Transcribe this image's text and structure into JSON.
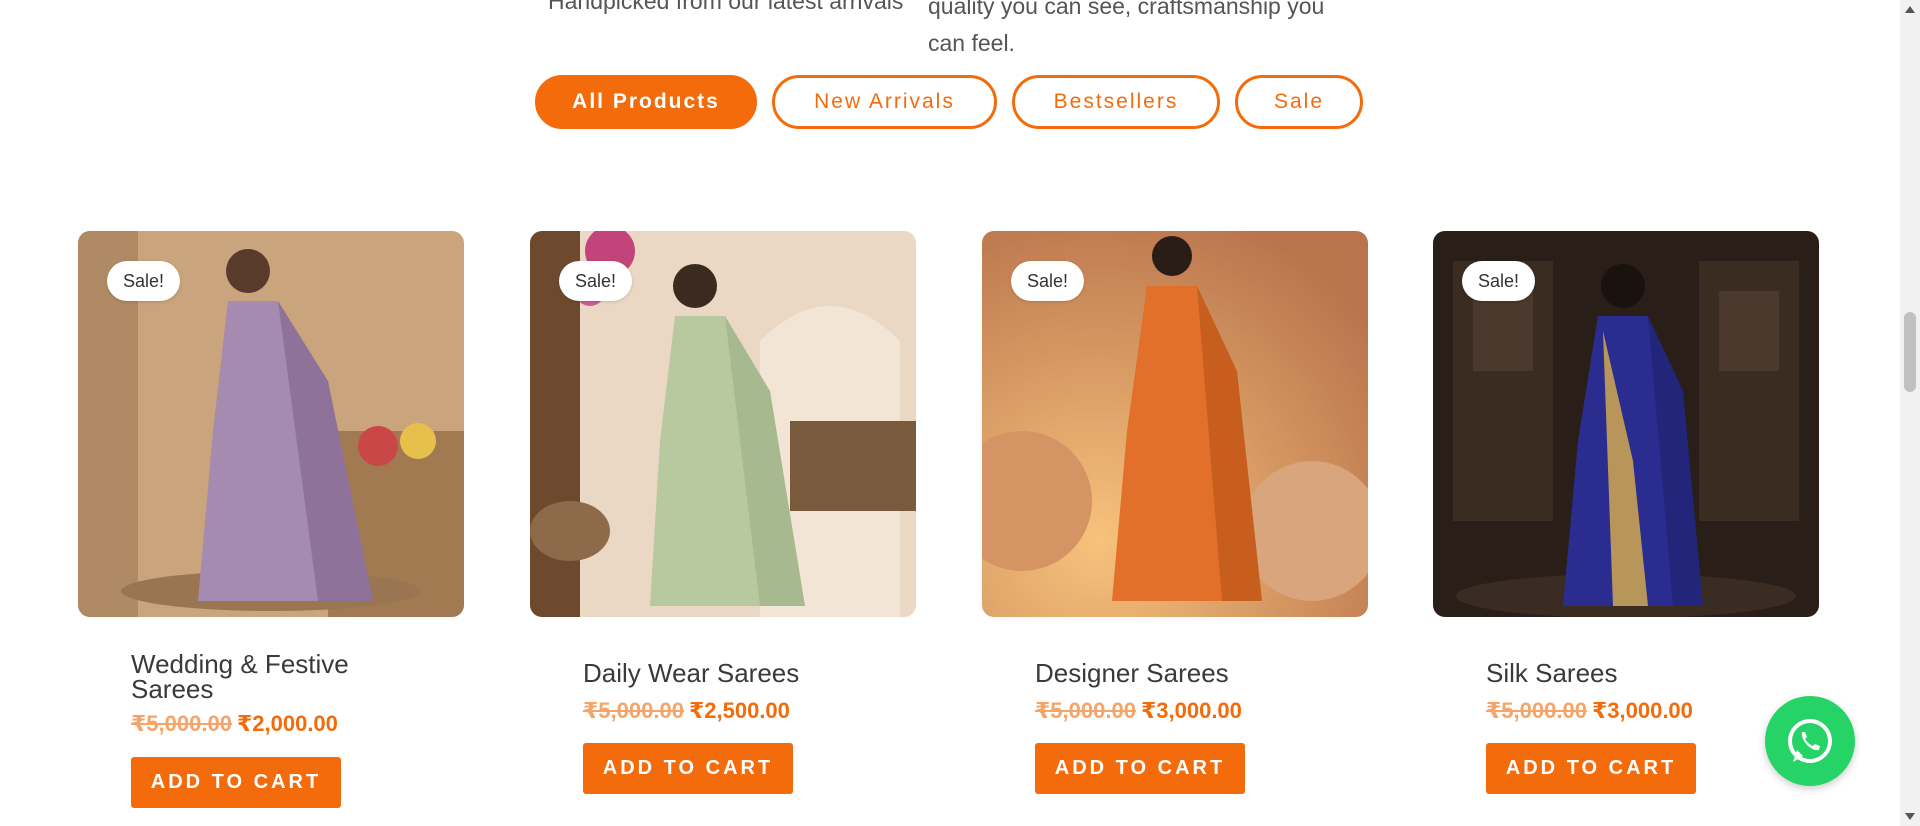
{
  "intro": {
    "left_text": "Handpicked from our latest arrivals",
    "right_text": "quality you can see, craftsmanship you can feel."
  },
  "tabs": [
    {
      "label": "All Products",
      "active": true
    },
    {
      "label": "New Arrivals",
      "active": false
    },
    {
      "label": "Bestsellers",
      "active": false
    },
    {
      "label": "Sale",
      "active": false
    }
  ],
  "products": [
    {
      "badge": "Sale!",
      "title": "Wedding & Festive Sarees",
      "old_price": "₹5,000.00",
      "price": "₹2,000.00",
      "cart_label": "ADD TO CART",
      "saree_color": "#a58bb0"
    },
    {
      "badge": "Sale!",
      "title": "Daily Wear Sarees",
      "old_price": "₹5,000.00",
      "price": "₹2,500.00",
      "cart_label": "ADD TO CART",
      "saree_color": "#b8c9a0"
    },
    {
      "badge": "Sale!",
      "title": "Designer Sarees",
      "old_price": "₹5,000.00",
      "price": "₹3,000.00",
      "cart_label": "ADD TO CART",
      "saree_color": "#e2702a"
    },
    {
      "badge": "Sale!",
      "title": "Silk Sarees",
      "old_price": "₹5,000.00",
      "price": "₹3,000.00",
      "cart_label": "ADD TO CART",
      "saree_color": "#2a2d8f"
    }
  ],
  "colors": {
    "accent": "#f36b0b",
    "whatsapp": "#25d366"
  }
}
